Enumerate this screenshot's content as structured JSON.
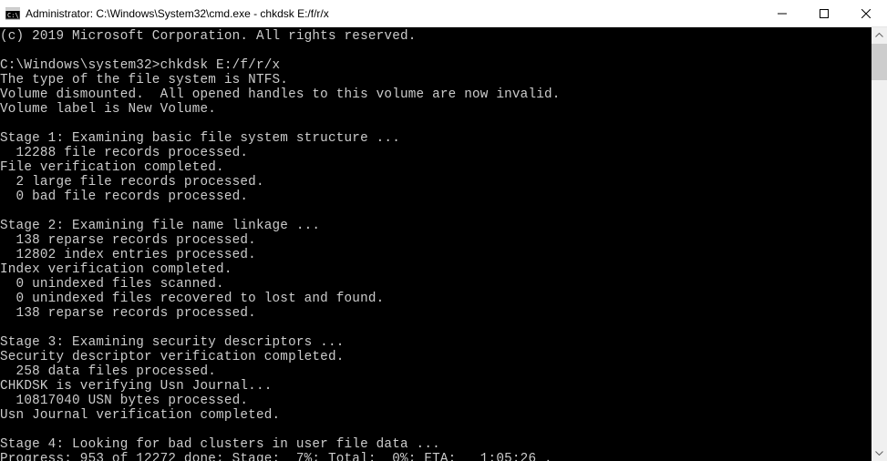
{
  "titlebar": {
    "title": "Administrator: C:\\Windows\\System32\\cmd.exe - chkdsk  E:/f/r/x"
  },
  "console": {
    "lines": [
      "(c) 2019 Microsoft Corporation. All rights reserved.",
      "",
      "C:\\Windows\\system32>chkdsk E:/f/r/x",
      "The type of the file system is NTFS.",
      "Volume dismounted.  All opened handles to this volume are now invalid.",
      "Volume label is New Volume.",
      "",
      "Stage 1: Examining basic file system structure ...",
      "  12288 file records processed.",
      "File verification completed.",
      "  2 large file records processed.",
      "  0 bad file records processed.",
      "",
      "Stage 2: Examining file name linkage ...",
      "  138 reparse records processed.",
      "  12802 index entries processed.",
      "Index verification completed.",
      "  0 unindexed files scanned.",
      "  0 unindexed files recovered to lost and found.",
      "  138 reparse records processed.",
      "",
      "Stage 3: Examining security descriptors ...",
      "Security descriptor verification completed.",
      "  258 data files processed.",
      "CHKDSK is verifying Usn Journal...",
      "  10817040 USN bytes processed.",
      "Usn Journal verification completed.",
      "",
      "Stage 4: Looking for bad clusters in user file data ...",
      "Progress: 953 of 12272 done; Stage:  7%; Total:  0%; ETA:   1:05:26 ."
    ]
  }
}
